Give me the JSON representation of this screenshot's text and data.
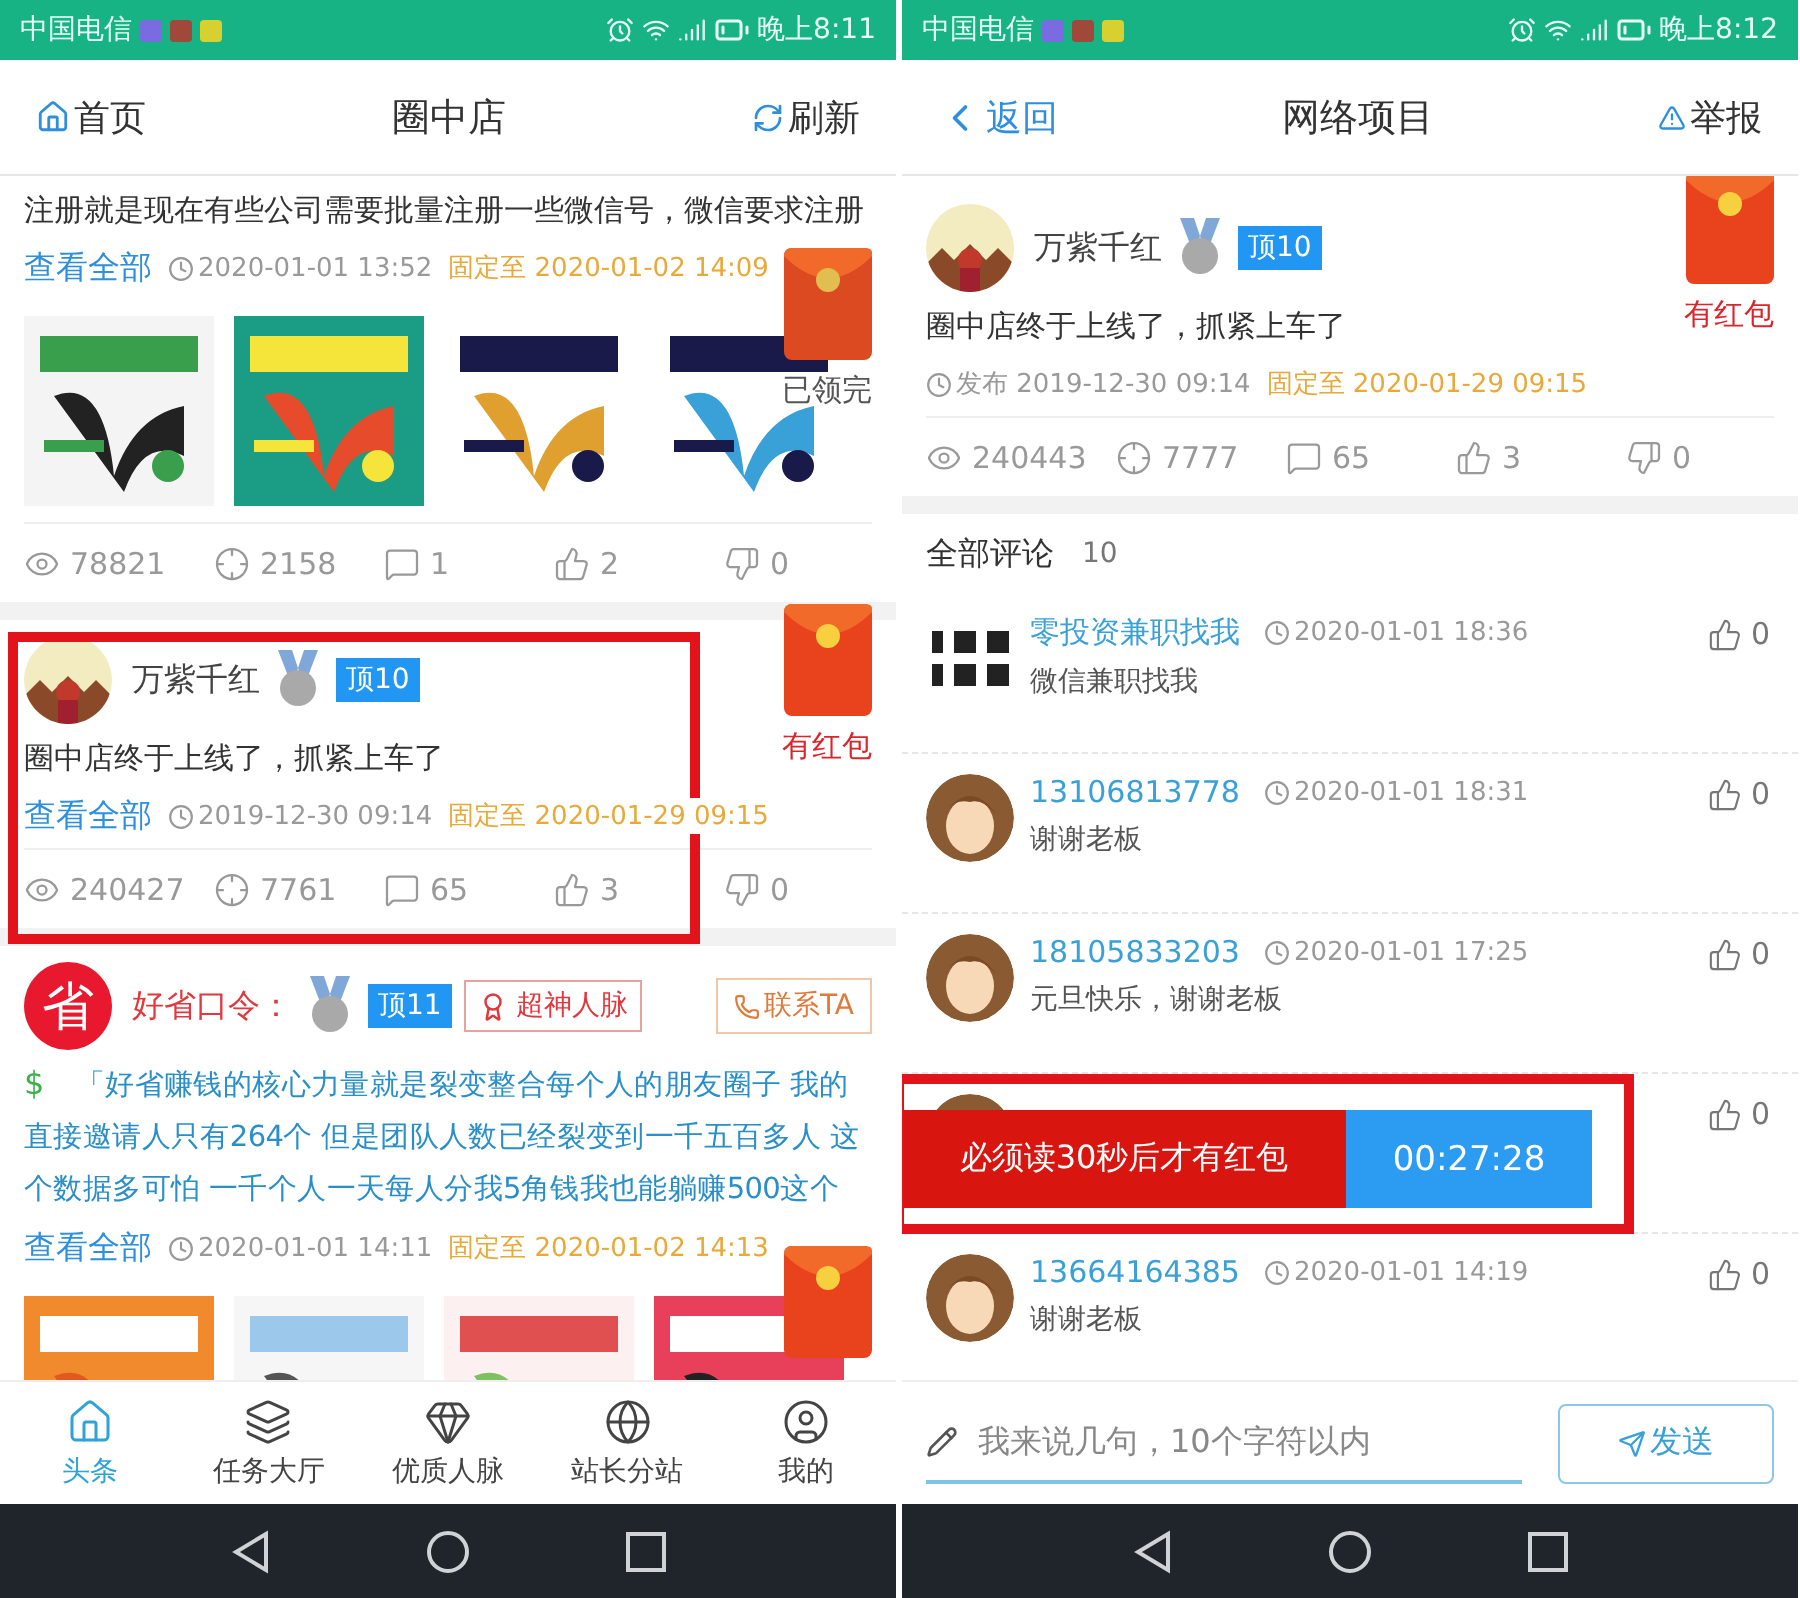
{
  "left_screen": {
    "status_bar": {
      "carrier": "中国电信",
      "time": "晚上8:11"
    },
    "header": {
      "home": "首页",
      "title": "圈中店",
      "refresh": "刷新"
    },
    "posts": [
      {
        "kind": "plain",
        "text": "注册就是现在有些公司需要批量注册一些微信号，微信要求注册",
        "view_all": "查看全部",
        "time": "2020-01-01 13:52",
        "pinned": "固定至 2020-01-02 14:09",
        "stats": [
          "78821",
          "2158",
          "1",
          "2",
          "0"
        ],
        "envelope": {
          "claimed": true,
          "label": "已领完"
        },
        "highlighted": false
      },
      {
        "kind": "plain",
        "author": "万紫千红",
        "level": "顶10",
        "text": "圈中店终于上线了，抓紧上车了",
        "view_all": "查看全部",
        "time": "2019-12-30 09:14",
        "pinned": "固定至 2020-01-29 09:15",
        "stats": [
          "240427",
          "7761",
          "65",
          "3",
          "0"
        ],
        "envelope": {
          "claimed": false,
          "label": "有红包"
        },
        "highlighted": true
      },
      {
        "kind": "promo",
        "avatar_text": "省",
        "author": "好省口令：",
        "level": "顶11",
        "tag": "超神人脉",
        "contact": "联系TA",
        "prefix": "$",
        "text": "「好省赚钱的核心力量就是裂变整合每个人的朋友圈子 我的直接邀请人只有264个 但是团队人数已经裂变到一千五百多人 这个数据多可怕 一千个人一天每人分我5角钱我也能躺赚500这个",
        "view_all": "查看全部",
        "time": "2020-01-01 14:11",
        "pinned": "固定至 2020-01-02 14:13",
        "envelope": {
          "claimed": false
        },
        "highlighted": false
      }
    ],
    "bottom_nav": [
      {
        "label": "头条",
        "selected": true
      },
      {
        "label": "任务大厅",
        "selected": false
      },
      {
        "label": "优质人脉",
        "selected": false
      },
      {
        "label": "站长分站",
        "selected": false
      },
      {
        "label": "我的",
        "selected": false
      }
    ]
  },
  "right_screen": {
    "status_bar": {
      "carrier": "中国电信",
      "time": "晚上8:12"
    },
    "header": {
      "back": "返回",
      "title": "网络项目",
      "report": "举报"
    },
    "post": {
      "author": "万紫千红",
      "level": "顶10",
      "text": "圈中店终于上线了，抓紧上车了",
      "published": "发布 2019-12-30 09:14",
      "pinned": "固定至 2020-01-29 09:15",
      "stats": [
        "240443",
        "7777",
        "65",
        "3",
        "0"
      ],
      "envelope": {
        "claimed": false,
        "label": "有红包"
      }
    },
    "comments_header": {
      "title": "全部评论",
      "count": "10"
    },
    "comments": [
      {
        "kind": "qr",
        "name": "零投资兼职找我",
        "time": "2020-01-01 18:36",
        "text": "微信兼职找我",
        "likes": "0"
      },
      {
        "kind": "face",
        "name": "13106813778",
        "time": "2020-01-01 18:31",
        "text": "谢谢老板",
        "likes": "0"
      },
      {
        "kind": "face",
        "name": "18105833203",
        "time": "2020-01-01 17:25",
        "text": "元旦快乐，谢谢老板",
        "likes": "0"
      },
      {
        "kind": "face",
        "likes": "0",
        "banner": {
          "text": "必须读30秒后才有红包",
          "timer": "00:27:28",
          "highlighted": true
        }
      },
      {
        "kind": "face",
        "name": "13664164385",
        "time": "2020-01-01 14:19",
        "text": "谢谢老板",
        "likes": "0"
      }
    ],
    "comment_input": {
      "placeholder": "我来说几句，10个字符以内",
      "send": "发送"
    }
  }
}
